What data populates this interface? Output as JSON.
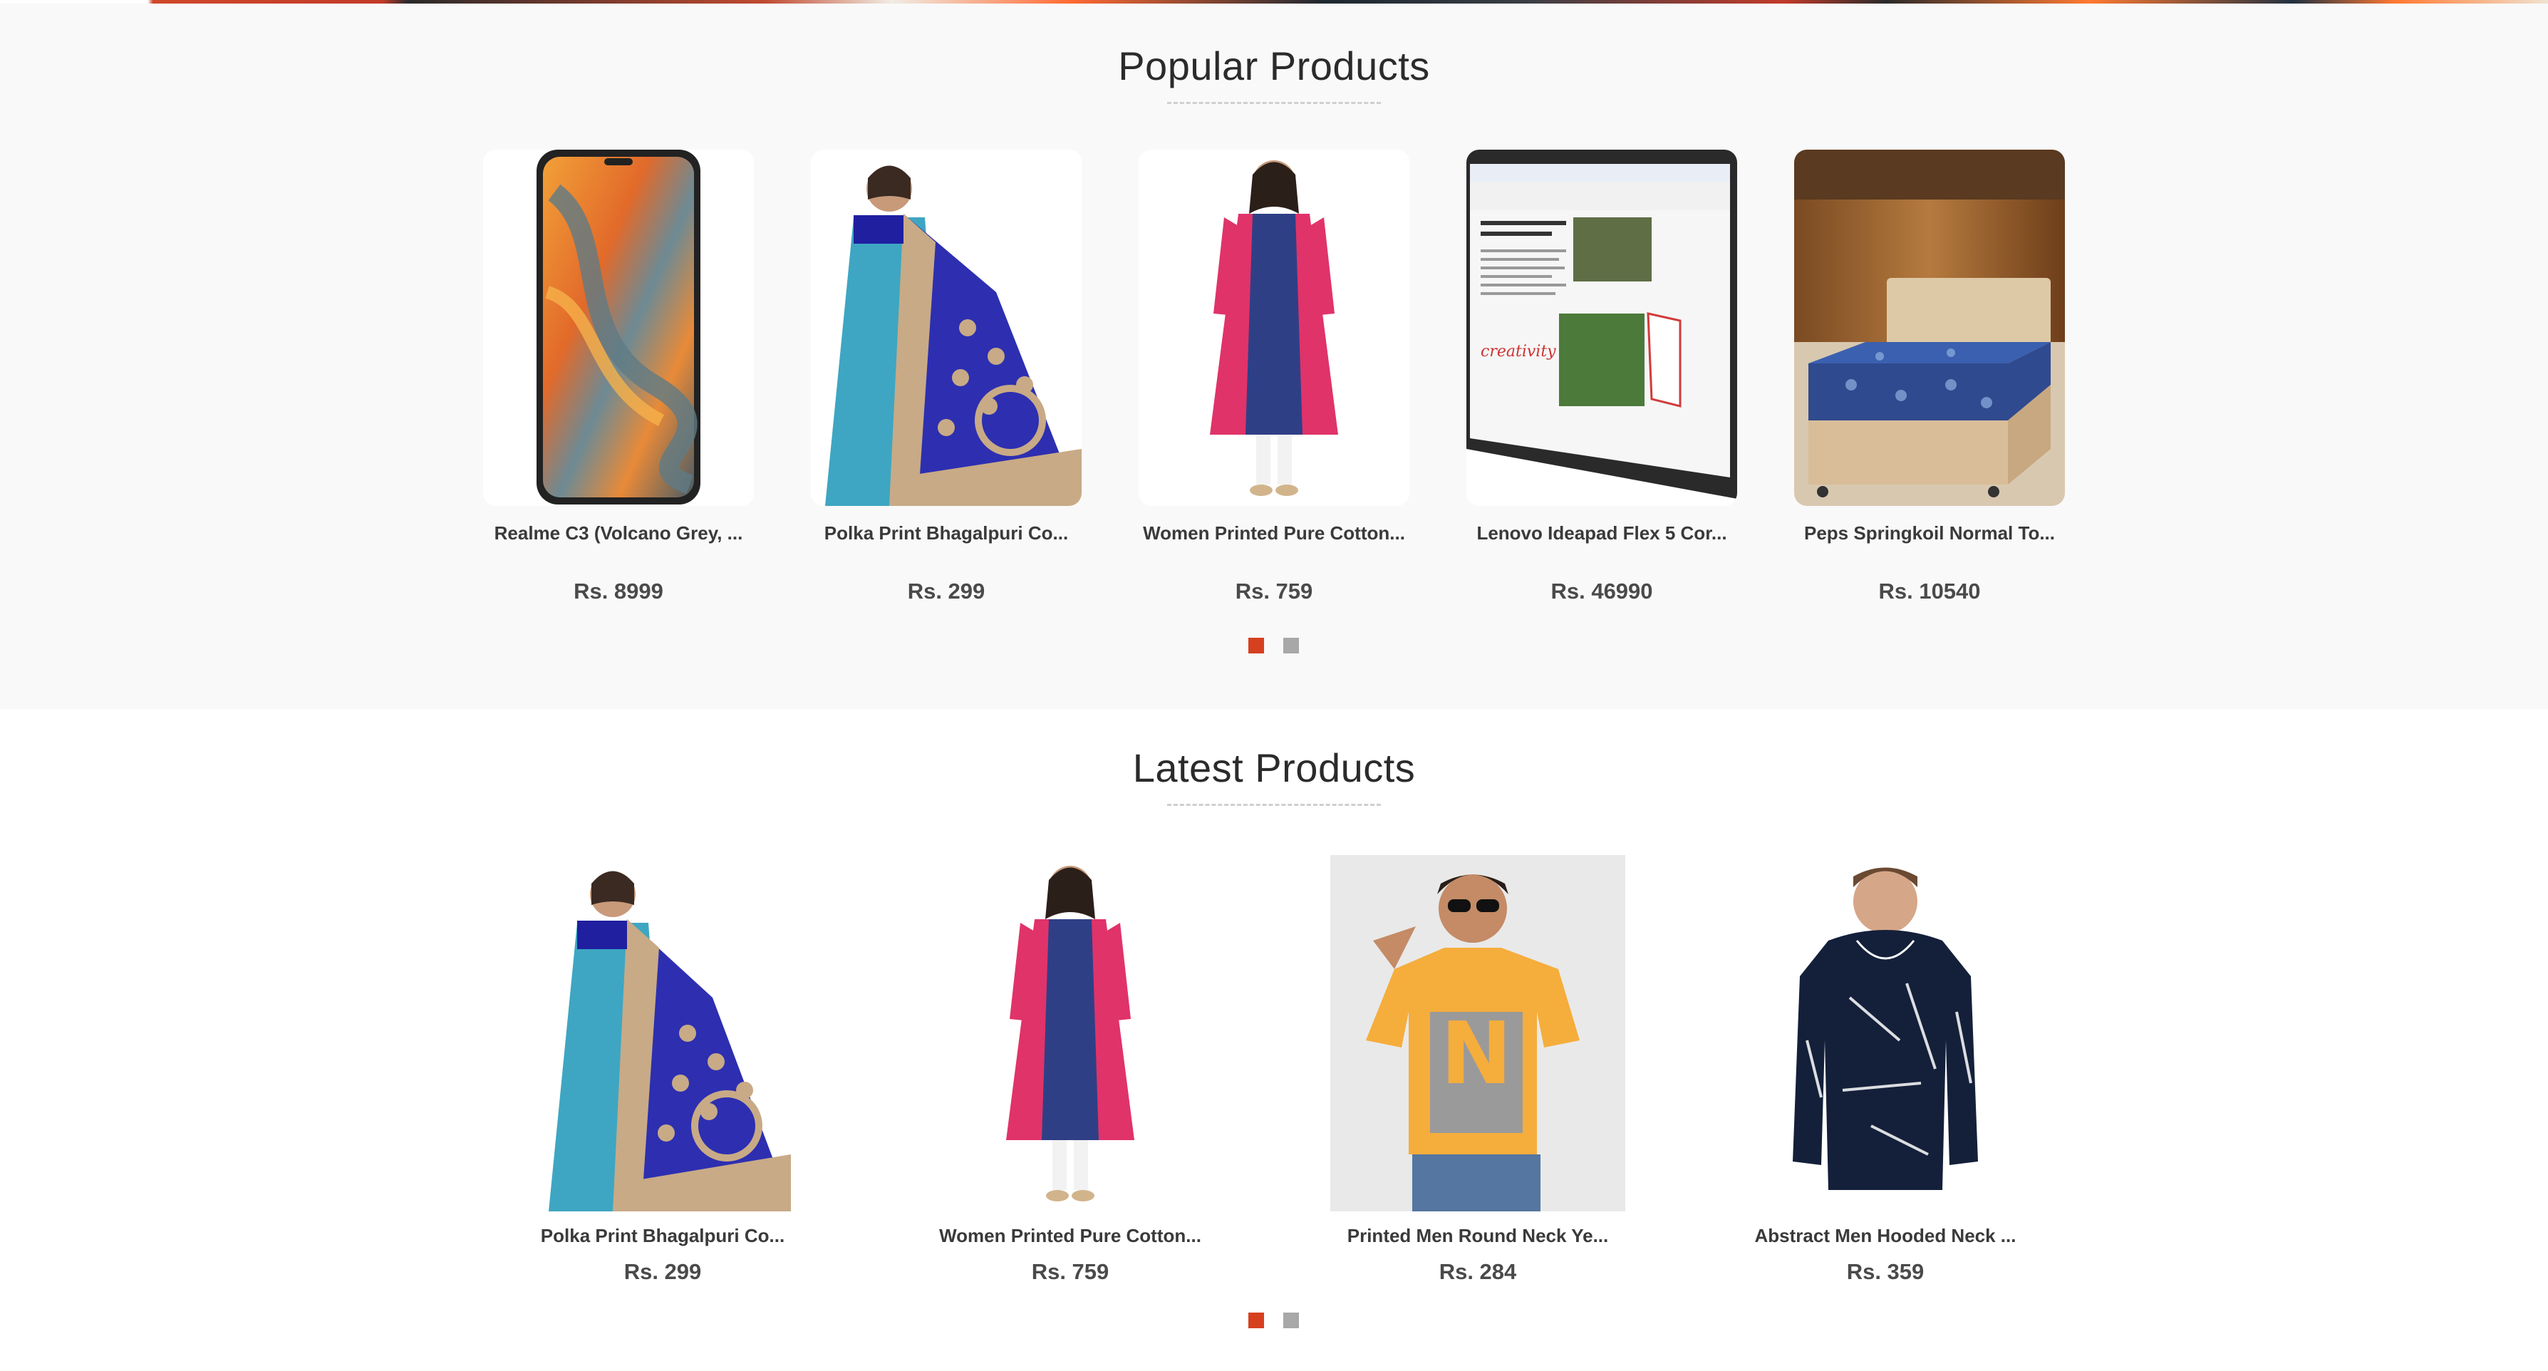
{
  "colors": {
    "accent": "#d6401f",
    "inactive_dot": "#a8a8a8",
    "section_bg": "#f9f9f9"
  },
  "popular": {
    "title": "Popular Products",
    "products": [
      {
        "name": "Realme C3 (Volcano Grey, ...",
        "price": "Rs. 8999",
        "image": "phone"
      },
      {
        "name": "Polka Print Bhagalpuri Co...",
        "price": "Rs. 299",
        "image": "saree"
      },
      {
        "name": "Women Printed Pure Cotton...",
        "price": "Rs. 759",
        "image": "kurta"
      },
      {
        "name": "Lenovo Ideapad Flex 5 Cor...",
        "price": "Rs. 46990",
        "image": "laptop"
      },
      {
        "name": "Peps Springkoil Normal To...",
        "price": "Rs. 10540",
        "image": "mattress"
      }
    ]
  },
  "latest": {
    "title": "Latest Products",
    "products": [
      {
        "name": "Polka Print Bhagalpuri Co...",
        "price": "Rs. 299",
        "image": "saree"
      },
      {
        "name": "Women Printed Pure Cotton...",
        "price": "Rs. 759",
        "image": "kurta"
      },
      {
        "name": "Printed Men Round Neck Ye...",
        "price": "Rs. 284",
        "image": "tshirt"
      },
      {
        "name": "Abstract Men Hooded Neck ...",
        "price": "Rs. 359",
        "image": "hoodie"
      }
    ]
  }
}
